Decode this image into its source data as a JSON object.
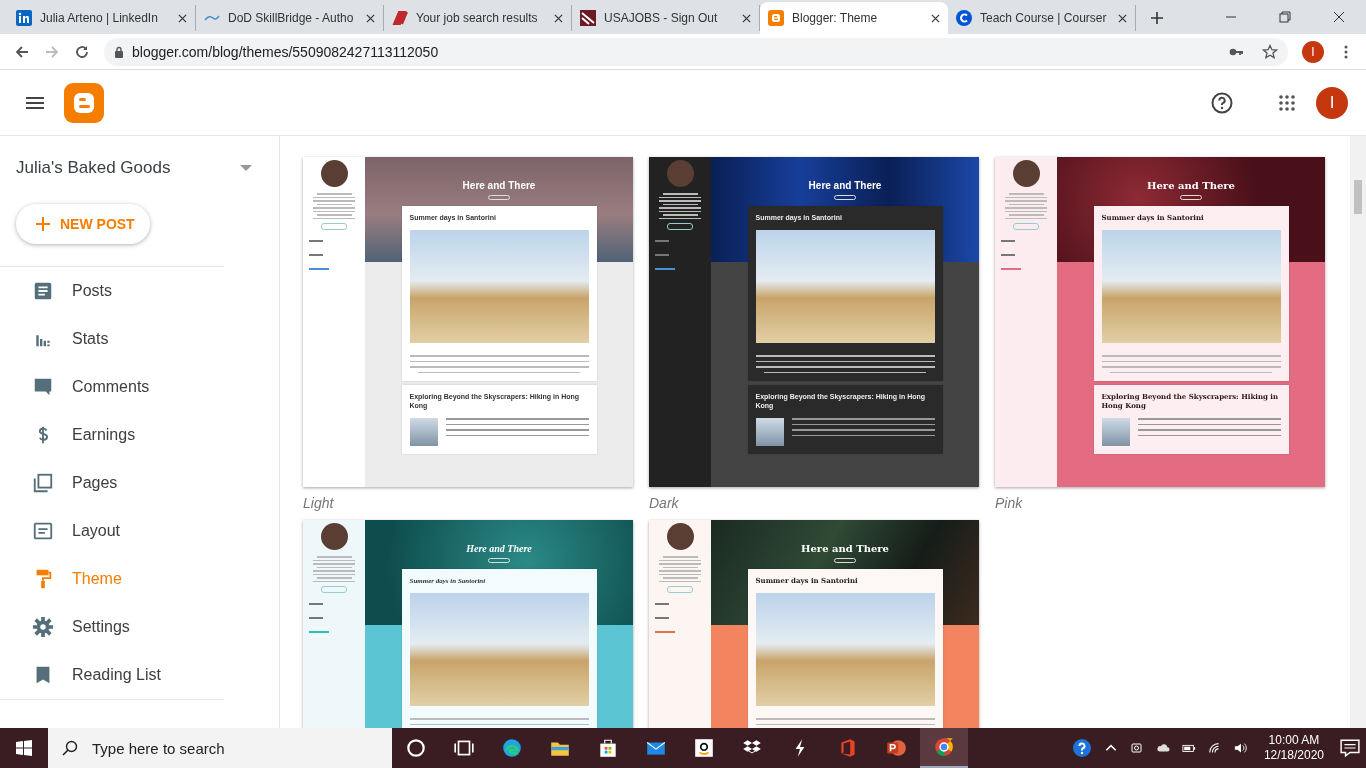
{
  "browser": {
    "tabs": [
      {
        "title": "Julia Arteno | LinkedIn",
        "selected": false
      },
      {
        "title": "DoD SkillBridge - Autho",
        "selected": false
      },
      {
        "title": "Your job search results",
        "selected": false
      },
      {
        "title": "USAJOBS - Sign Out",
        "selected": false
      },
      {
        "title": "Blogger: Theme",
        "selected": true
      },
      {
        "title": "Teach Course | Courser",
        "selected": false
      }
    ],
    "address": "blogger.com/blog/themes/5509082427113112050",
    "profile_initial": "I"
  },
  "header": {
    "avatar_initial": "I"
  },
  "sidebar": {
    "blog_name": "Julia's Baked Goods",
    "new_post": "NEW POST",
    "items": [
      {
        "label": "Posts",
        "selected": false
      },
      {
        "label": "Stats",
        "selected": false
      },
      {
        "label": "Comments",
        "selected": false
      },
      {
        "label": "Earnings",
        "selected": false
      },
      {
        "label": "Pages",
        "selected": false
      },
      {
        "label": "Layout",
        "selected": false
      },
      {
        "label": "Theme",
        "selected": true
      },
      {
        "label": "Settings",
        "selected": false
      },
      {
        "label": "Reading List",
        "selected": false
      }
    ]
  },
  "themes": [
    {
      "name": "Light",
      "kind": "light",
      "blog_title": "Here and There",
      "posts": [
        "Summer days in Santorini",
        "Exploring Beyond the Skyscrapers: Hiking in Hong Kong"
      ]
    },
    {
      "name": "Dark",
      "kind": "dark",
      "blog_title": "Here and There",
      "posts": [
        "Summer days in Santorini",
        "Exploring Beyond the Skyscrapers: Hiking in Hong Kong"
      ]
    },
    {
      "name": "Pink",
      "kind": "pink",
      "blog_title": "Here and There",
      "posts": [
        "Summer days in Santorini",
        "Exploring Beyond the Skyscrapers: Hiking in Hong Kong"
      ]
    },
    {
      "kind": "aqua",
      "blog_title": "Here and There",
      "posts": [
        "Summer days in Santorini"
      ]
    },
    {
      "kind": "tropical",
      "blog_title": "Here and There",
      "posts": [
        "Summer days in Santorini"
      ]
    }
  ],
  "taskbar": {
    "search_placeholder": "Type here to search",
    "time": "10:00 AM",
    "date": "12/18/2020"
  }
}
